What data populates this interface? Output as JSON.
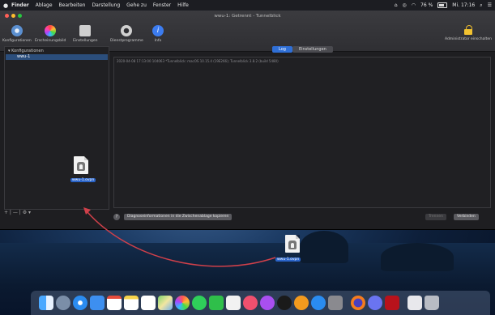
{
  "menubar": {
    "apple": "",
    "items": [
      "Finder",
      "Ablage",
      "Bearbeiten",
      "Darstellung",
      "Gehe zu",
      "Fenster",
      "Hilfe"
    ],
    "battery": "76 %",
    "datetime": "Mi. 17:16"
  },
  "window": {
    "title": "wwu-1: Getrennt - Tunnelblick",
    "toolbar": [
      {
        "label": "Konfigurationen",
        "icon": "gear-icon",
        "color": "#5b8fd0"
      },
      {
        "label": "Erscheinungsbild",
        "icon": "color-wheel-icon",
        "color": "#d86adf"
      },
      {
        "label": "Einstellungen",
        "icon": "settings-panel-icon",
        "color": "#cfcfcf"
      },
      {
        "label": "Dienstprogramme",
        "icon": "tools-icon",
        "color": "#d0d0d0"
      },
      {
        "label": "Info",
        "icon": "info-icon",
        "color": "#3c7cf0"
      }
    ],
    "admin_label": "Administrator einschalten"
  },
  "sidebar": {
    "header": "▾ Konfigurationen",
    "selected_item": "wwu-1",
    "footer": "+ | — | ⚙ ▾",
    "file_label": "wwu-1.ovpn"
  },
  "main": {
    "tabs": [
      "Log",
      "Einstellungen"
    ],
    "log_line": "2020-04-08 17:13:00 104063 *Tunnelblick: macOS 10.15.4 (19E266); Tunnelblick 3.8.2 (build 5480)",
    "copy_button": "Diagnoseinformationen in die Zwischenablage kopieren",
    "disconnect_button": "Trennen",
    "connect_button": "Verbinden"
  },
  "desktop": {
    "file_label": "wwu-1.ovpn"
  },
  "colors": {
    "accent": "#2f6fd6",
    "arrow": "#d0404a"
  }
}
